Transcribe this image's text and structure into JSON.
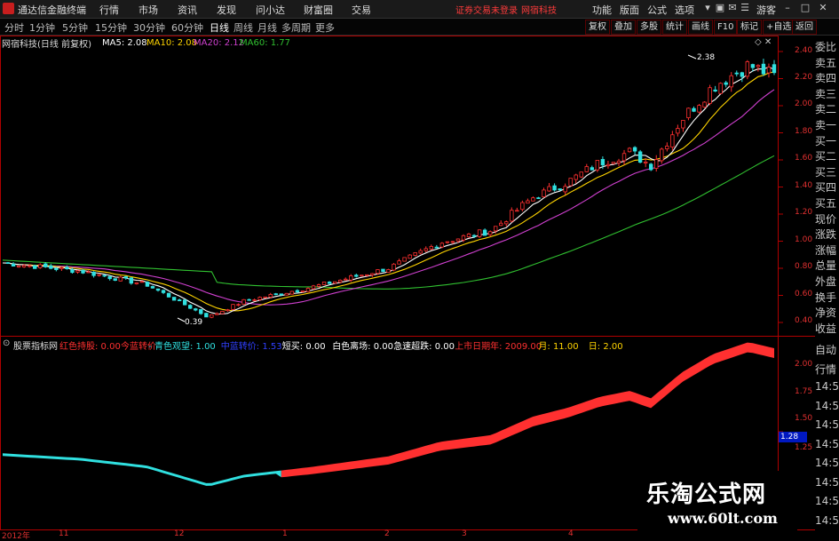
{
  "titlebar": {
    "app_name": "通达信金融终端",
    "menus": [
      "行情",
      "市场",
      "资讯",
      "发现",
      "问小达",
      "财富圈",
      "交易"
    ],
    "notice": "证券交易未登录",
    "stock_name": "网宿科技",
    "right_menus": [
      "功能",
      "版面",
      "公式",
      "选项"
    ],
    "user": "游客"
  },
  "periods": {
    "items": [
      "分时",
      "1分钟",
      "5分钟",
      "15分钟",
      "30分钟",
      "60分钟",
      "日线",
      "周线",
      "月线",
      "多周期",
      "更多"
    ],
    "active": "日线"
  },
  "right_tools": [
    "复权",
    "叠加",
    "多股",
    "统计",
    "画线",
    "F10",
    "标记",
    "+自选",
    "返回"
  ],
  "chart_header": {
    "title": "网宿科技(日线 前复权)",
    "ma": [
      {
        "label": "MA5: 2.08",
        "color": "#ffffff"
      },
      {
        "label": "MA10: 2.08",
        "color": "#ffd400"
      },
      {
        "label": "MA20: 2.12",
        "color": "#d040d0"
      },
      {
        "label": "MA60: 1.77",
        "color": "#30c030"
      }
    ]
  },
  "price_axis": [
    "2.40",
    "2.20",
    "2.00",
    "1.80",
    "1.60",
    "1.40",
    "1.20",
    "1.00",
    "0.80",
    "0.60",
    "0.40"
  ],
  "annotations": {
    "high": "2.38",
    "low": "0.39"
  },
  "right_panel": [
    "委比",
    "卖五",
    "卖四",
    "卖三",
    "卖二",
    "卖一",
    "买一",
    "买二",
    "买三",
    "买四",
    "买五",
    "现价",
    "涨跌",
    "涨幅",
    "总量",
    "外盘",
    "换手",
    "净资",
    "收益"
  ],
  "indicator": {
    "name": "股票指标网",
    "legend": [
      {
        "text": "红色持股: 0.00",
        "color": "#ff3030"
      },
      {
        "text": "今蓝转价",
        "color": "#ff3030"
      },
      {
        "text": "- 青色观望: 1.00",
        "color": "#30e0e0"
      },
      {
        "text": "中蓝转价: 1.53",
        "color": "#3040ff"
      },
      {
        "text": "短买: 0.00",
        "color": "#ffffff"
      },
      {
        "text": "白色离场: 0.00",
        "color": "#ffffff"
      },
      {
        "text": "急速超跌: 0.00",
        "color": "#ffffff"
      },
      {
        "text": "上市日期年: 2009.00",
        "color": "#ff3030"
      },
      {
        "text": "月: 11.00",
        "color": "#ffd400"
      },
      {
        "text": "日: 2.00",
        "color": "#ffd400"
      }
    ],
    "axis": [
      "2.00",
      "1.75",
      "1.50",
      "1.25"
    ],
    "current": "1.28"
  },
  "lower_right_panel": [
    "自动",
    "行情",
    "14:5",
    "14:5",
    "14:5",
    "14:5",
    "14:5",
    "14:5",
    "14:5",
    "14:5"
  ],
  "x_axis": [
    "2012年",
    "11",
    "12",
    "1",
    "2",
    "3",
    "4"
  ],
  "watermark": {
    "title": "乐淘公式网",
    "url": "www.60lt.com"
  },
  "colors": {
    "up": "#ff3030",
    "down": "#30e0e0",
    "ma5": "#ffffff",
    "ma10": "#ffd400",
    "ma20": "#d040d0",
    "ma60": "#30c030",
    "frame": "#b00000"
  }
}
